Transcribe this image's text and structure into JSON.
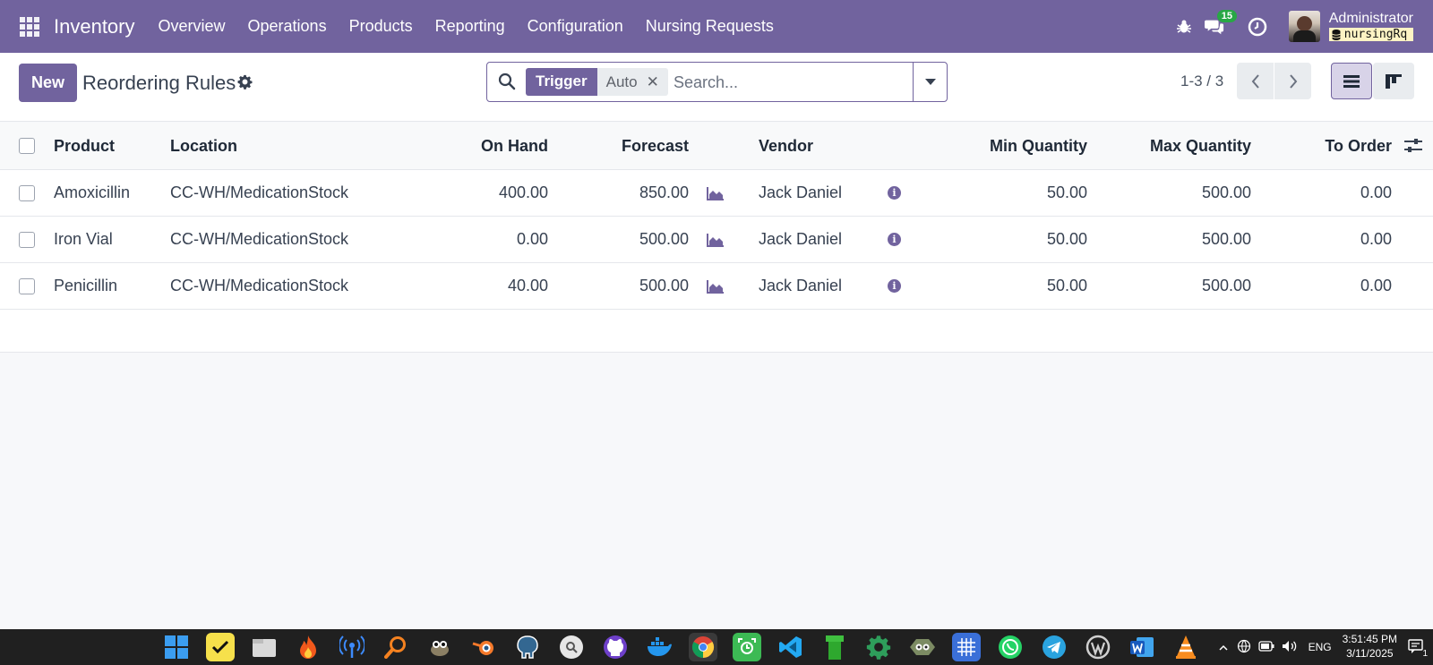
{
  "navbar": {
    "brand": "Inventory",
    "menu": [
      "Overview",
      "Operations",
      "Products",
      "Reporting",
      "Configuration",
      "Nursing Requests"
    ],
    "chat_count": "15",
    "user_name": "Administrator",
    "database": "nursingRq"
  },
  "control": {
    "new_label": "New",
    "title": "Reordering Rules",
    "search": {
      "facet_label": "Trigger",
      "facet_value": "Auto",
      "placeholder": "Search..."
    },
    "pager": "1-3 / 3"
  },
  "table": {
    "columns": {
      "product": "Product",
      "location": "Location",
      "on_hand": "On Hand",
      "forecast": "Forecast",
      "vendor": "Vendor",
      "min_qty": "Min Quantity",
      "max_qty": "Max Quantity",
      "to_order": "To Order"
    },
    "rows": [
      {
        "product": "Amoxicillin",
        "location": "CC-WH/MedicationStock",
        "on_hand": "400.00",
        "forecast": "850.00",
        "vendor": "Jack Daniel",
        "min_qty": "50.00",
        "max_qty": "500.00",
        "to_order": "0.00"
      },
      {
        "product": "Iron Vial",
        "location": "CC-WH/MedicationStock",
        "on_hand": "0.00",
        "forecast": "500.00",
        "vendor": "Jack Daniel",
        "min_qty": "50.00",
        "max_qty": "500.00",
        "to_order": "0.00"
      },
      {
        "product": "Penicillin",
        "location": "CC-WH/MedicationStock",
        "on_hand": "40.00",
        "forecast": "500.00",
        "vendor": "Jack Daniel",
        "min_qty": "50.00",
        "max_qty": "500.00",
        "to_order": "0.00"
      }
    ]
  },
  "taskbar": {
    "apps": [
      "windows-start",
      "sticky-notes",
      "file-explorer",
      "fire-app",
      "wifi-analyzer",
      "search-app",
      "gimp",
      "blender",
      "postgresql",
      "search-tool",
      "github-desktop",
      "docker",
      "chrome",
      "screen-capture",
      "vscode",
      "green-pipe",
      "gear-app",
      "eye-app",
      "grid-app",
      "whatsapp",
      "telegram",
      "wordpress",
      "word",
      "vlc"
    ],
    "language": "ENG",
    "time": "3:51:45 PM",
    "date": "3/11/2025",
    "notification_count": "1"
  },
  "colors": {
    "brand": "#71639e",
    "badge_green": "#28a745"
  }
}
